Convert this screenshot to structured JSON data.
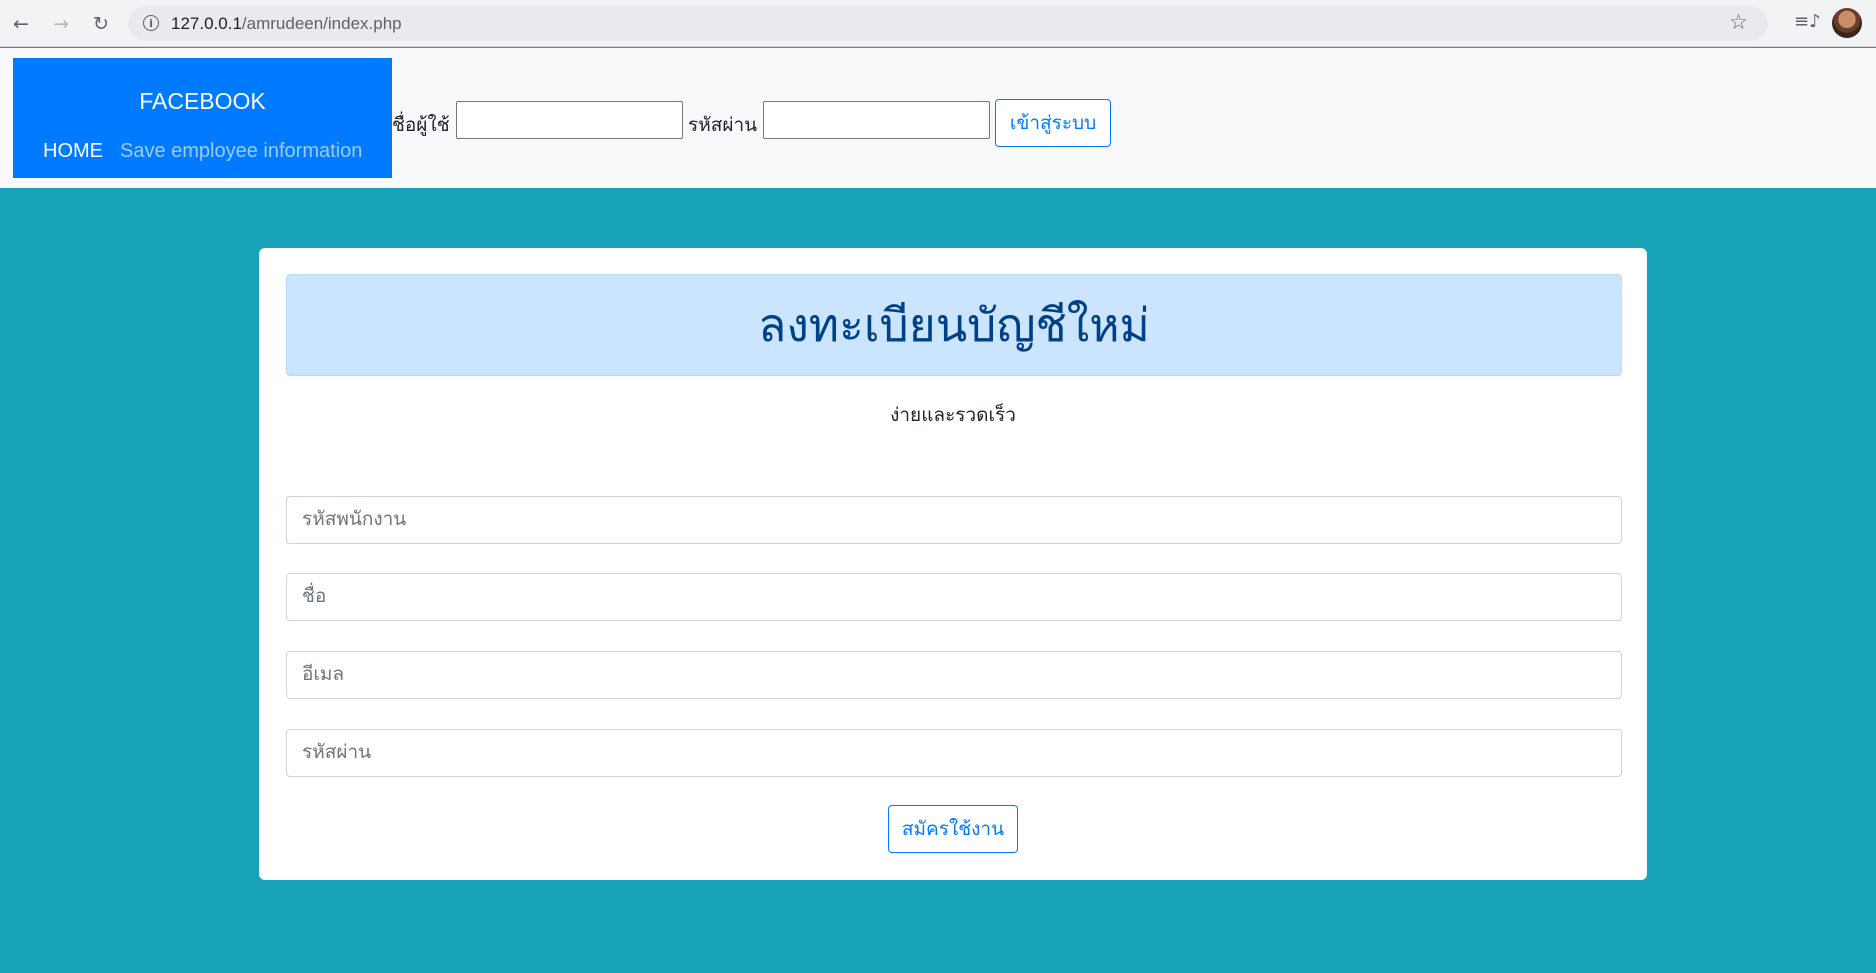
{
  "browser": {
    "url_host": "127.0.0.1",
    "url_path": "/amrudeen/index.php",
    "icons": [
      "back-arrow-icon",
      "forward-arrow-icon",
      "reload-icon",
      "info-icon",
      "star-icon",
      "playlist-icon",
      "profile-avatar"
    ]
  },
  "navbar": {
    "brand": "FACEBOOK",
    "home_label": "HOME",
    "save_label": "Save employee information",
    "username_label": "ชื่อผู้ใช้",
    "password_label": "รหัสผ่าน",
    "username_value": "",
    "password_value": "",
    "login_button": "เข้าสู่ระบบ"
  },
  "register": {
    "title": "ลงทะเบียนบัญชีใหม่",
    "subtitle": "ง่ายและรวดเร็ว",
    "fields": {
      "employee_id_placeholder": "รหัสพนักงาน",
      "name_placeholder": "ชื่อ",
      "email_placeholder": "อีเมล",
      "password_placeholder": "รหัสผ่าน"
    },
    "submit_button": "สมัครใช้งาน"
  },
  "colors": {
    "page_background": "#17a2b8",
    "brand_background": "#007bff",
    "alert_background": "#cce5ff",
    "alert_text": "#004085",
    "button_outline": "#007bff"
  }
}
